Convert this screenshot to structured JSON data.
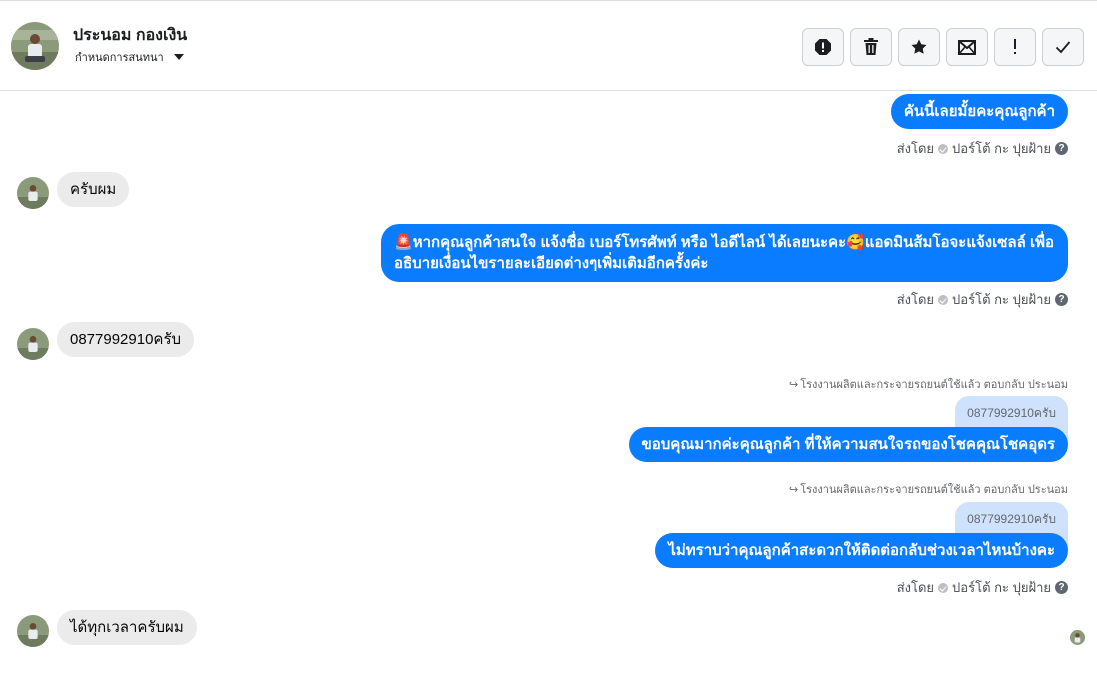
{
  "header": {
    "contact_name": "ประนอม กองเงิน",
    "assign_label": "กำหนดการสนทนา",
    "actions": [
      {
        "name": "report-spam",
        "icon": "exclamation-octagon-icon"
      },
      {
        "name": "delete",
        "icon": "trash-icon"
      },
      {
        "name": "star",
        "icon": "star-icon"
      },
      {
        "name": "mark-unread",
        "icon": "envelope-icon"
      },
      {
        "name": "follow-up",
        "icon": "exclamation-icon"
      },
      {
        "name": "mark-done",
        "icon": "check-icon"
      }
    ]
  },
  "messages": {
    "m1": "คันนี้เลยมั้ยคะคุณลูกค้า",
    "m1_sent_by": "ส่งโดย",
    "m1_sender": "ปอร์โต้ กะ ปุยฝ้าย",
    "m2": "ครับผม",
    "m3_line1": "🚨หากคุณลูกค้าสนใจ แจ้งชื่อ เบอร์โทรศัพท์ หรือ ไอดีไลน์  ได้เลยนะคะ🥰แอดมินส้มโอจะแจ้งเซลล์  เพื่อ",
    "m3_line2": "อธิบายเงื่อนไขรายละเอียดต่างๆเพิ่มเติมอีกครั้งค่ะ",
    "m3_sent_by": "ส่งโดย",
    "m3_sender": "ปอร์โต้ กะ ปุยฝ้าย",
    "m4": "0877992910ครับ",
    "m5_reply_meta": "โรงงานผลิตและกระจายรถยนต์ใช้แล้ว ตอบกลับ ประนอม",
    "m5_quote": "0877992910ครับ",
    "m5": "ขอบคุณมากค่ะคุณลูกค้า ที่ให้ความสนใจรถของโชคคุณโชคอุดร",
    "m6_reply_meta": "โรงงานผลิตและกระจายรถยนต์ใช้แล้ว ตอบกลับ ประนอม",
    "m6_quote": "0877992910ครับ",
    "m6": "ไม่ทราบว่าคุณลูกค้าสะดวกให้ติดต่อกลับช่วงเวลาไหนบ้างคะ",
    "m6_sent_by": "ส่งโดย",
    "m6_sender": "ปอร์โต้ กะ ปุยฝ้าย",
    "m7": "ได้ทุกเวลาครับผม"
  },
  "colors": {
    "outgoing": "#0a7cff",
    "incoming": "#ebebeb",
    "quote": "#cfe2fd"
  }
}
